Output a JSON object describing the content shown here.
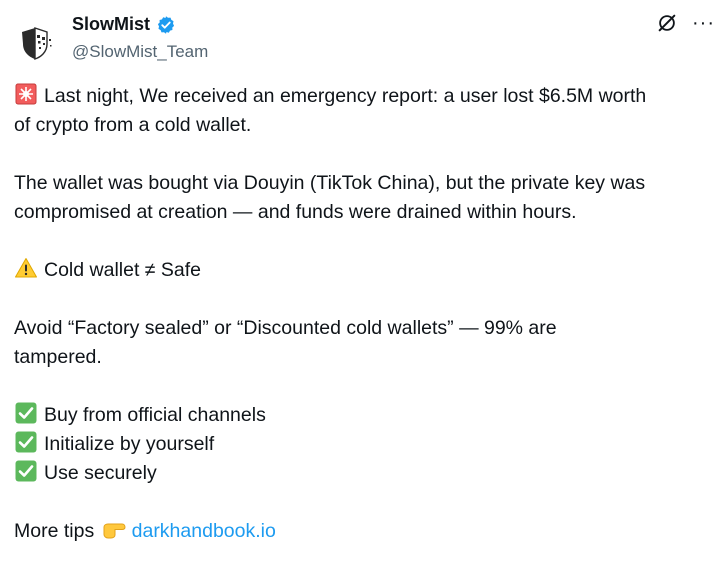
{
  "author": {
    "display_name": "SlowMist",
    "handle": "@SlowMist_Team",
    "verified": true,
    "avatar_icon": "slowmist-logo-icon"
  },
  "header_actions": {
    "grok_icon": "grok-icon",
    "more_label": "···"
  },
  "tweet": {
    "p1": {
      "emoji_icon": "rotating-light-icon",
      "line1": "Last night, We received an emergency report: a user lost $6.5M worth",
      "line2": "of crypto from a cold wallet."
    },
    "p2": {
      "line1": "The wallet was bought via Douyin (TikTok China), but the private key was",
      "line2": "compromised at creation — and funds were drained within hours."
    },
    "p3": {
      "emoji_icon": "warning-icon",
      "text": "Cold wallet ≠ Safe"
    },
    "p4": {
      "line1": "Avoid “Factory sealed” or “Discounted cold wallets” — 99% are",
      "line2": "tampered."
    },
    "checklist": [
      {
        "emoji_icon": "check-mark-button-icon",
        "text": "Buy from official channels"
      },
      {
        "emoji_icon": "check-mark-button-icon",
        "text": "Initialize by yourself"
      },
      {
        "emoji_icon": "check-mark-button-icon",
        "text": "Use securely"
      }
    ],
    "more_tips": {
      "text": "More tips",
      "emoji_icon": "pointing-right-icon",
      "link_text": "darkhandbook.io"
    }
  },
  "colors": {
    "text": "#0f1419",
    "secondary": "#536471",
    "link": "#1d9bf0",
    "verified": "#1d9bf0",
    "check_green": "#5cb85c"
  }
}
